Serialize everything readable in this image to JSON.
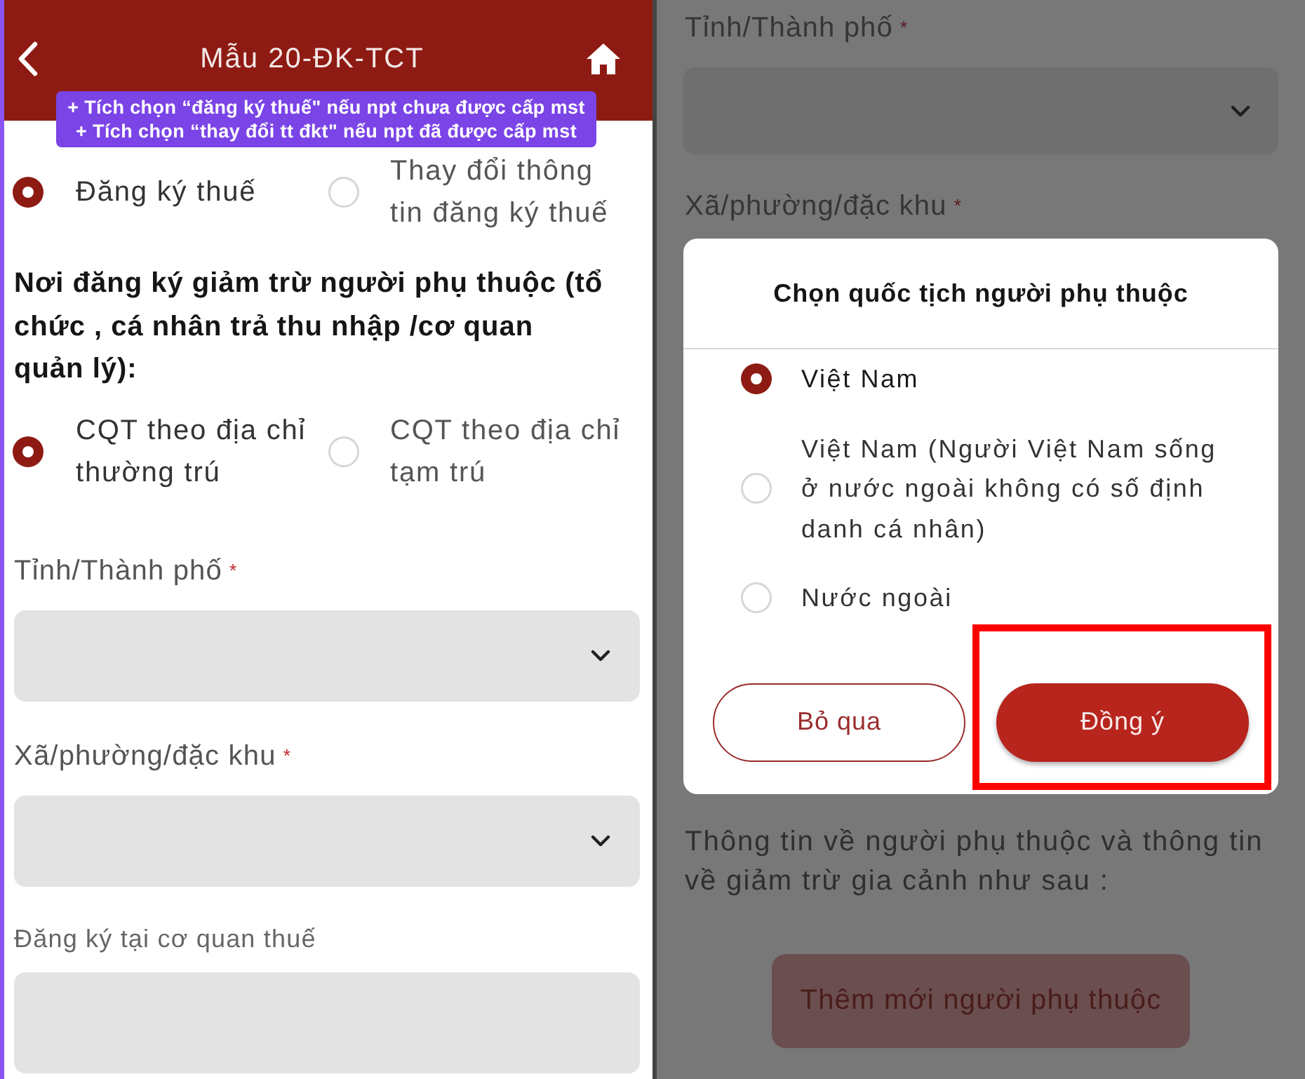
{
  "left_screen": {
    "header": {
      "title": "Mẫu 20-ĐK-TCT"
    },
    "hint_banner": {
      "lines": [
        "+ Tích chọn “đăng ký thuế\" nếu npt chưa được cấp mst",
        "+ Tích chọn “thay đổi tt đkt\" nếu npt đã được cấp mst"
      ]
    },
    "registration_options": [
      {
        "label": "Đăng ký thuế",
        "selected": true
      },
      {
        "label": "Thay đổi thông tin đăng ký thuế",
        "selected": false
      }
    ],
    "deduction_place": {
      "heading": "Nơi đăng ký giảm trừ người phụ thuộc (tổ chức , cá nhân trả thu nhập /cơ quan quản lý):",
      "options": [
        {
          "label": "CQT theo địa chỉ thường trú",
          "selected": true
        },
        {
          "label": "CQT theo địa chỉ tạm trú",
          "selected": false
        }
      ]
    },
    "fields": [
      {
        "kind": "dropdown",
        "label": "Tỉnh/Thành phố",
        "required_mark": "*"
      },
      {
        "kind": "dropdown",
        "label": "Xã/phường/đặc khu",
        "required_mark": "*"
      },
      {
        "kind": "text",
        "label": "Đăng ký tại cơ quan thuế"
      }
    ]
  },
  "right_screen": {
    "fields": [
      {
        "kind": "dropdown",
        "label": "Tỉnh/Thành phố",
        "required_mark": "*"
      },
      {
        "kind": "label",
        "label": "Xã/phường/đặc khu",
        "required_mark": "*"
      }
    ],
    "dialog": {
      "title": "Chọn quốc tịch người phụ thuộc",
      "options": [
        {
          "label": "Việt Nam",
          "selected": true
        },
        {
          "label": "Việt Nam (Người Việt Nam sống ở nước ngoài không có số định danh cá nhân)",
          "selected": false
        },
        {
          "label": "Nước ngoài",
          "selected": false
        }
      ],
      "buttons": [
        {
          "kind": "outline",
          "label": "Bỏ qua",
          "highlighted": false
        },
        {
          "kind": "filled",
          "label": "Đồng ý",
          "highlighted": true
        }
      ]
    },
    "info_text": "Thông tin về người phụ thuộc và thông tin về giảm trừ gia cảnh như sau :",
    "add_button": {
      "label": "Thêm mới người phụ thuộc"
    }
  }
}
